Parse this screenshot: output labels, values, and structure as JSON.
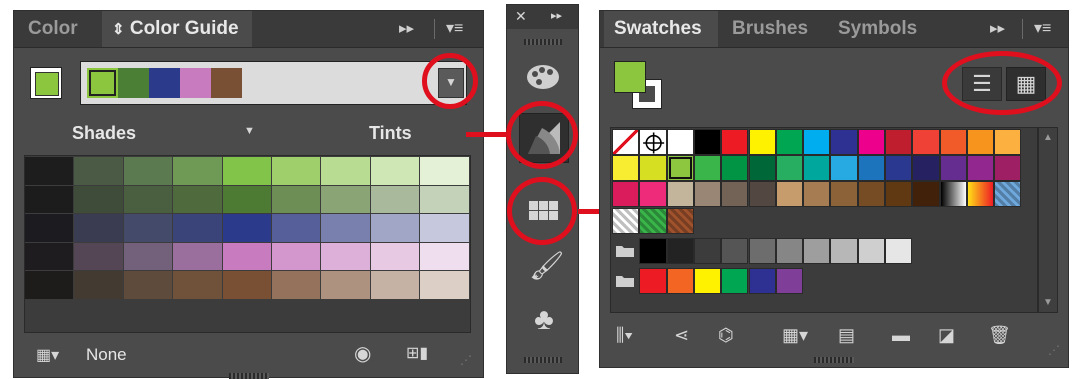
{
  "color_panel": {
    "tabs": [
      {
        "label": "Color"
      },
      {
        "label": "Color Guide",
        "glyph": "⇕"
      }
    ],
    "active_color": "#8cc63f",
    "harmony_colors": [
      "#8cc63f",
      "#4a7f35",
      "#2b3a8a",
      "#c97bbf",
      "#7a5034"
    ],
    "shades_label": "Shades",
    "tints_label": "Tints",
    "grid": [
      [
        "#1d1d1d",
        "#4a5a44",
        "#5c7a50",
        "#6e9a55",
        "#82c34a",
        "#9fcf6a",
        "#b8dc92",
        "#cfe7b5",
        "#e4f1d6"
      ],
      [
        "#1c1c1c",
        "#3f4c3a",
        "#4a5e40",
        "#4f6a3c",
        "#4d7b33",
        "#6d8f55",
        "#8aa476",
        "#a8ba9b",
        "#c4d2b9"
      ],
      [
        "#1c1c20",
        "#3a3d52",
        "#444a6a",
        "#3a4478",
        "#2b3a8a",
        "#565f9a",
        "#7a80ae",
        "#a1a6c6",
        "#c6c9dd"
      ],
      [
        "#1e1c1e",
        "#554656",
        "#73607a",
        "#9a6f9e",
        "#c97bbf",
        "#d497cd",
        "#dcb0d8",
        "#e7c9e3",
        "#efdeed"
      ],
      [
        "#1e1c1a",
        "#433a31",
        "#5e4b3b",
        "#6f5239",
        "#7a5034",
        "#94725b",
        "#ad927f",
        "#c5b2a4",
        "#dcd0c6"
      ]
    ],
    "footer_label": "None"
  },
  "tools_strip": {
    "icons": [
      "palette-icon",
      "color-guide-icon",
      "swatches-icon",
      "brushes-icon",
      "symbols-icon"
    ],
    "close_glyph": "✕",
    "expand_glyph": "▸▸"
  },
  "swatches_panel": {
    "tabs": [
      {
        "label": "Swatches"
      },
      {
        "label": "Brushes"
      },
      {
        "label": "Symbols"
      }
    ],
    "fill_color": "#8cc63f",
    "rows": [
      [
        "none",
        "registration",
        "#ffffff",
        "#000000",
        "#ed1c24",
        "#fff200",
        "#00a651",
        "#00aeef",
        "#2e3192",
        "#ec008c",
        "#be1e2d",
        "#ef4136",
        "#f15a29",
        "#f7941d",
        "#fbb040"
      ],
      [
        "#f9ed32",
        "#d7df23",
        "selected:#8dc63f",
        "#39b54a",
        "#009444",
        "#006838",
        "#27ae60",
        "#00a79d",
        "#27aae1",
        "#1c75bc",
        "#2b388f",
        "#262262",
        "#662d91",
        "#92278f",
        "#9e1f63"
      ],
      [
        "#da1c5c",
        "#ee2a7b",
        "#c2b59b",
        "#998675",
        "#736357",
        "#534741",
        "#c69c6d",
        "#a67c52",
        "#8c6239",
        "#754c24",
        "#603913",
        "#42210b",
        "gradient:#000000:#ffffff",
        "gradient:#ffde17:#ed1c24",
        "pattern:#6fa8dc"
      ]
    ],
    "pattern_row": [
      "pattern:#ffffff",
      "pattern:#39b54a",
      "pattern:#a0522d"
    ],
    "gray_group": [
      "#000000",
      "#232323",
      "#3c3c3c",
      "#555555",
      "#6d6d6d",
      "#868686",
      "#9e9e9e",
      "#b7b7b7",
      "#cfcfcf",
      "#e6e6e6"
    ],
    "bright_group": [
      "#ed1c24",
      "#f26522",
      "#fff200",
      "#00a651",
      "#2e3192",
      "#7f3f98"
    ]
  }
}
